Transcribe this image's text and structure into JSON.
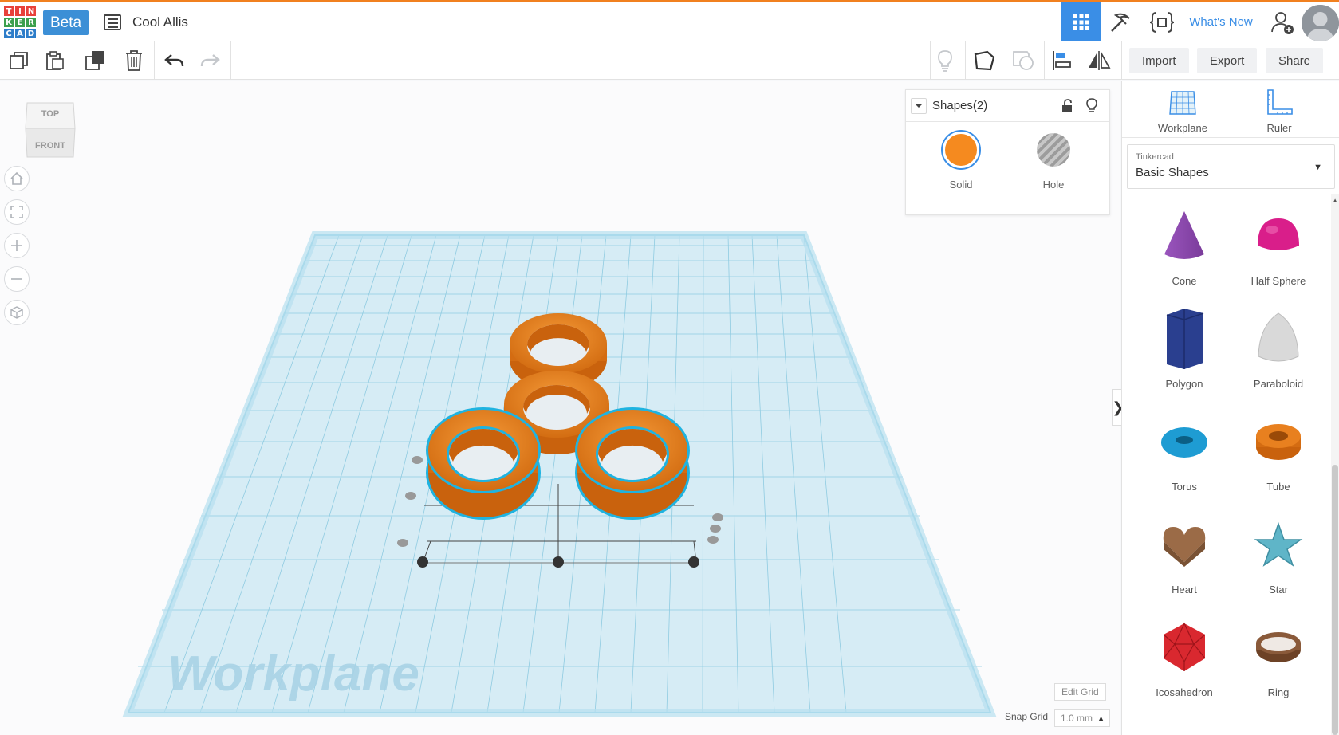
{
  "app": {
    "logo_letters": [
      "T",
      "I",
      "N",
      "K",
      "E",
      "R",
      "C",
      "A",
      "D"
    ],
    "logo_colors": [
      "#e8413a",
      "#e8413a",
      "#e8413a",
      "#3ca04d",
      "#3ca04d",
      "#3ca04d",
      "#2d7dc9",
      "#2d7dc9",
      "#2d7dc9"
    ],
    "badge": "Beta",
    "design_name": "Cool Allis",
    "accent": "#f1801f",
    "brand_blue": "#3a8ee6"
  },
  "header": {
    "whats_new": "What's New",
    "icons": [
      "grid-view-icon",
      "pickaxe-icon",
      "codeblocks-icon",
      "add-user-icon",
      "avatar"
    ]
  },
  "toolbar": {
    "import_label": "Import",
    "export_label": "Export",
    "share_label": "Share",
    "icons": [
      "copy-icon",
      "paste-icon",
      "duplicate-icon",
      "delete-icon",
      "undo-icon",
      "redo-icon",
      "lightbulb-icon",
      "note-icon",
      "group-icon",
      "align-icon",
      "mirror-icon"
    ]
  },
  "viewcube": {
    "top_label": "TOP",
    "front_label": "FRONT"
  },
  "inspector": {
    "title": "Shapes(2)",
    "solid_label": "Solid",
    "hole_label": "Hole",
    "solid_color": "#f58a1f"
  },
  "workplane": {
    "watermark": "Workplane",
    "edit_grid_label": "Edit Grid",
    "snap_grid_label": "Snap Grid",
    "snap_grid_value": "1.0 mm"
  },
  "panel": {
    "workplane_label": "Workplane",
    "ruler_label": "Ruler",
    "library_provider": "Tinkercad",
    "library_name": "Basic Shapes",
    "shapes": [
      {
        "label": "Cone",
        "color": "#7a3b9a"
      },
      {
        "label": "Half Sphere",
        "color": "#d91e8a"
      },
      {
        "label": "Polygon",
        "color": "#2a3f8f"
      },
      {
        "label": "Paraboloid",
        "color": "#d9d9d9"
      },
      {
        "label": "Torus",
        "color": "#1e9cd3"
      },
      {
        "label": "Tube",
        "color": "#e8801f"
      },
      {
        "label": "Heart",
        "color": "#9b6b47"
      },
      {
        "label": "Star",
        "color": "#5fb5c8"
      },
      {
        "label": "Icosahedron",
        "color": "#d9282f"
      },
      {
        "label": "Ring",
        "color": "#8a5a3a"
      }
    ]
  }
}
